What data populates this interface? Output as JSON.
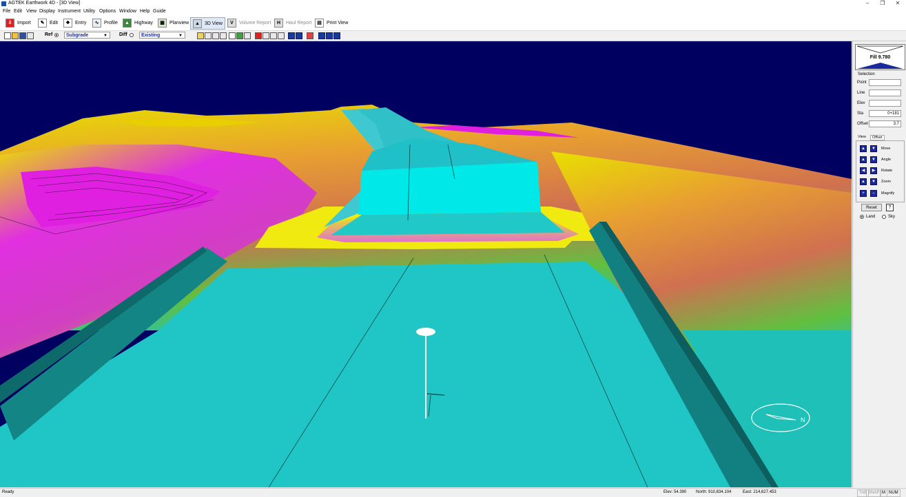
{
  "window": {
    "title": "AGTEK Earthwork 4D - [3D View]"
  },
  "menu": [
    "File",
    "Edit",
    "View",
    "Display",
    "Instrument",
    "Utility",
    "Options",
    "Window",
    "Help",
    "Guide"
  ],
  "tabs": [
    {
      "label": "Import",
      "icon": "import-icon",
      "state": "normal"
    },
    {
      "label": "Edit",
      "icon": "edit-icon",
      "state": "normal"
    },
    {
      "label": "Entry",
      "icon": "entry-icon",
      "state": "normal"
    },
    {
      "label": "Profile",
      "icon": "profile-icon",
      "state": "normal"
    },
    {
      "label": "Highway",
      "icon": "highway-icon",
      "state": "normal"
    },
    {
      "label": "Planview",
      "icon": "planview-icon",
      "state": "normal"
    },
    {
      "label": "3D View",
      "icon": "3d-view-icon",
      "state": "active"
    },
    {
      "label": "Volume Report",
      "icon": "volume-report-icon",
      "state": "disabled"
    },
    {
      "label": "Haul Report",
      "icon": "haul-report-icon",
      "state": "disabled"
    },
    {
      "label": "Print View",
      "icon": "print-view-icon",
      "state": "normal"
    }
  ],
  "toolbar": {
    "ref_label": "Ref",
    "ref_value": "Subgrade",
    "diff_label": "Diff",
    "diff_value": "Existing"
  },
  "panel": {
    "fill_text": "Fill 9.780",
    "selection_title": "Selection",
    "fields": [
      {
        "label": "Point",
        "value": ""
      },
      {
        "label": "Line",
        "value": ""
      },
      {
        "label": "Elev",
        "value": ""
      },
      {
        "label": "Sta",
        "value": "0+181"
      },
      {
        "label": "Offset",
        "value": "3.7"
      }
    ],
    "view_tabs": [
      "View",
      "Offset"
    ],
    "controls": [
      "Move",
      "Angle",
      "Rotate",
      "Zoom",
      "Magnify"
    ],
    "reset_label": "Reset",
    "help_label": "?",
    "mode_options": [
      "Land",
      "Sky"
    ],
    "mode_selected": "Land"
  },
  "status": {
    "ready": "Ready",
    "elev": "Elev: 54.390",
    "north": "North: 910,834.104",
    "east": "East: 214,627.453",
    "indicators": [
      {
        "label": "TAB",
        "on": false
      },
      {
        "label": "SNAP",
        "on": false
      },
      {
        "label": "M",
        "on": true
      },
      {
        "label": "NUM",
        "on": true
      }
    ]
  },
  "colors": {
    "sky": "#000060",
    "cut": "#00e5e5",
    "road": "#1fc7c5",
    "road_shoulder": "#138080",
    "fill_low": "#f0f000",
    "fill_high": "#e020e0",
    "mid": "#e07a50"
  }
}
